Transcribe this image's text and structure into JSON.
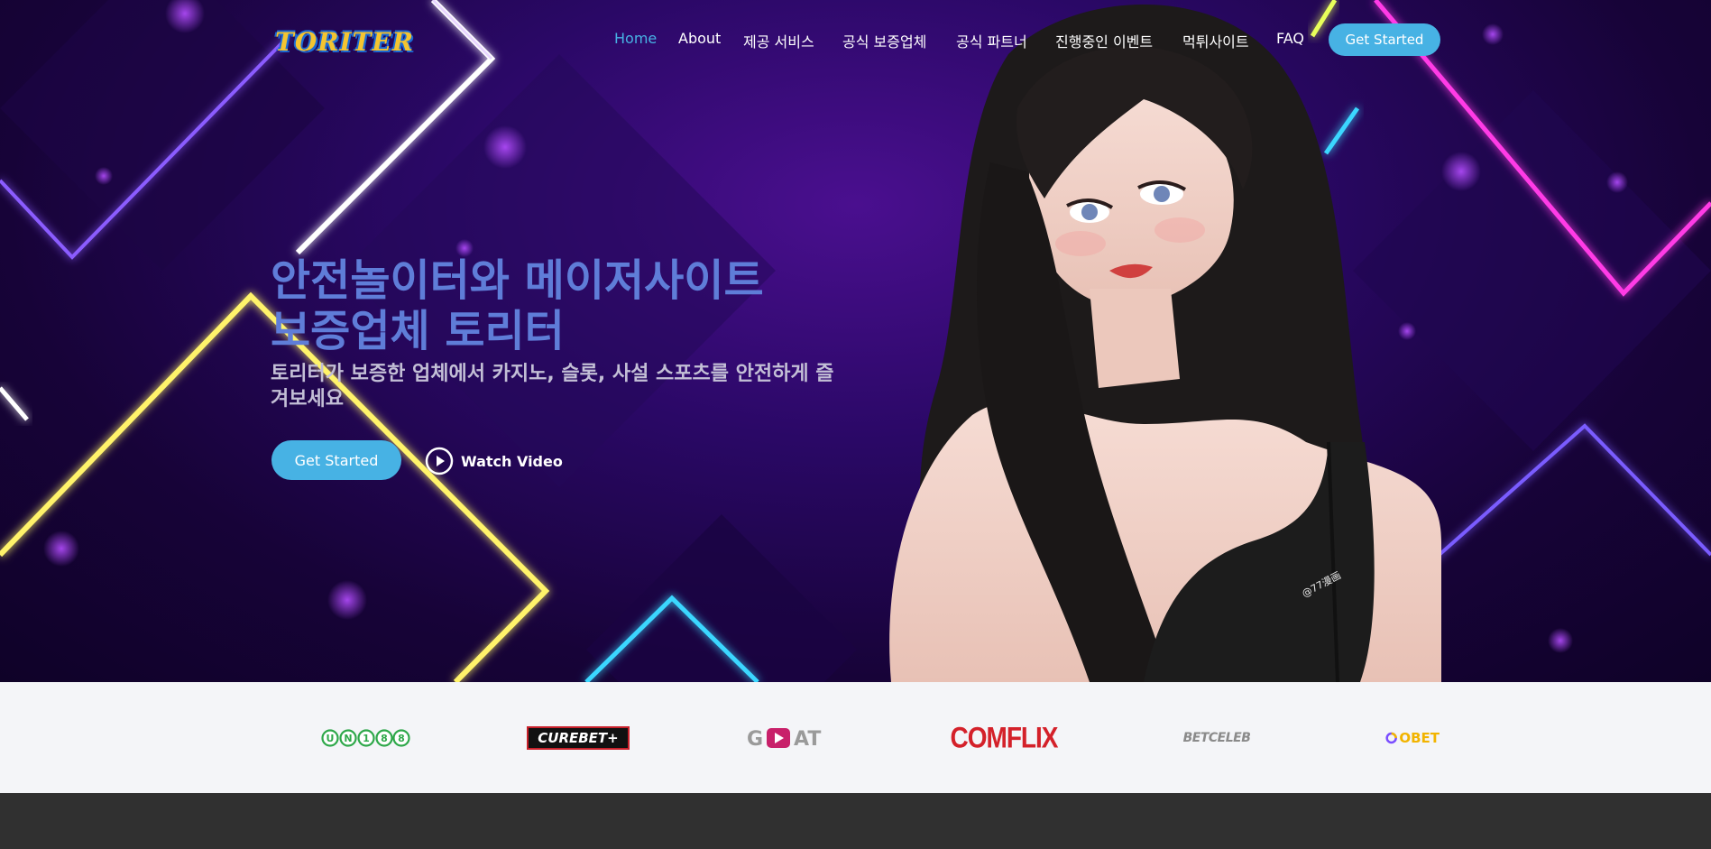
{
  "brand": {
    "logo_text": "TORITER"
  },
  "nav": {
    "items": [
      {
        "label": "Home",
        "active": true
      },
      {
        "label": "About"
      },
      {
        "label": "제공 서비스"
      },
      {
        "label": "공식 보증업체"
      },
      {
        "label": "공식 파트너"
      },
      {
        "label": "진행중인 이벤트"
      },
      {
        "label": "먹튀사이트"
      },
      {
        "label": "FAQ"
      }
    ],
    "cta_label": "Get Started"
  },
  "hero": {
    "title_line1": "안전놀이터와 메이저사이트",
    "title_line2": "보증업체 토리터",
    "subtitle": "토리터가 보증한 업체에서 카지노, 슬롯, 사설 스포츠를 안전하게 즐겨보세요",
    "cta_label": "Get Started",
    "watch_label": "Watch Video",
    "portrait_watermark": "@77漫画"
  },
  "clients": [
    {
      "name": "UN188 logo",
      "text": "UN188"
    },
    {
      "name": "CUREBET logo",
      "text": "CUREBET+"
    },
    {
      "name": "GOAT logo",
      "text": "GOAT"
    },
    {
      "name": "COMFLIX logo",
      "text": "COMFLIX"
    },
    {
      "name": "BETCELEB logo",
      "text": "BETCELEB"
    },
    {
      "name": "OBET logo",
      "text": "OBET"
    }
  ],
  "colors": {
    "accent": "#47b2e4",
    "headline": "#5f7dd8",
    "hero_bg": "#2a0866",
    "clients_bg": "#f4f5f8",
    "footer_bg": "#303030"
  }
}
